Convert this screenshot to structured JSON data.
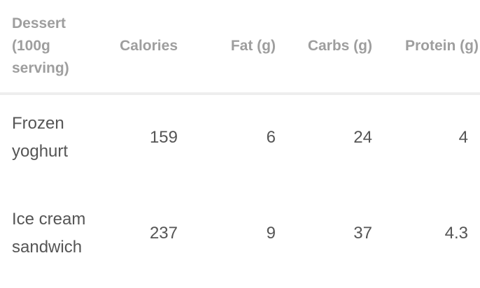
{
  "table": {
    "headers": {
      "dessert": "Dessert (100g serving)",
      "calories": "Calories",
      "fat": "Fat (g)",
      "carbs": "Carbs (g)",
      "protein": "Protein (g)"
    },
    "rows": [
      {
        "dessert": "Frozen yoghurt",
        "calories": "159",
        "fat": "6",
        "carbs": "24",
        "protein": "4"
      },
      {
        "dessert": "Ice cream sandwich",
        "calories": "237",
        "fat": "9",
        "carbs": "37",
        "protein": "4.3"
      }
    ]
  },
  "colors": {
    "header_text": "#9e9e9e",
    "body_text": "#555555",
    "divider": "#eeeeee",
    "background": "#ffffff"
  }
}
